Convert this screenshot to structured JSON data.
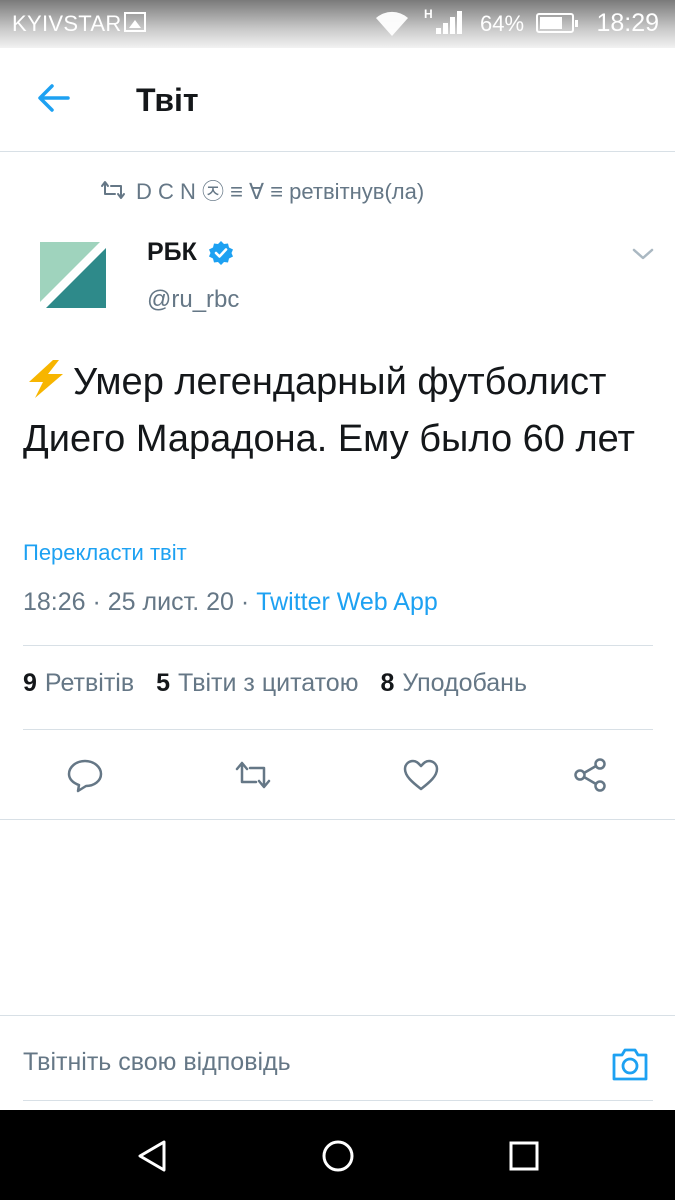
{
  "status_bar": {
    "carrier": "KYIVSTAR",
    "battery": "64%",
    "time": "18:29",
    "network": "H"
  },
  "header": {
    "title": "Твіт"
  },
  "retweet_context": {
    "text": "D C N ㉨ ≡ ∀ ≡ ретвітнув(ла)"
  },
  "tweet": {
    "author_name": "РБК",
    "author_handle": "@ru_rbc",
    "verified": true,
    "text": "Умер легендарный футболист Диего Марадона. Ему было 60 лет",
    "translate": "Перекласти твіт",
    "timestamp": "18:26 · 25 лист. 20 · ",
    "app": "Twitter Web App"
  },
  "stats": {
    "retweets_count": "9",
    "retweets_label": "Ретвітів",
    "quotes_count": "5",
    "quotes_label": "Твіти з цитатою",
    "likes_count": "8",
    "likes_label": "Уподобань"
  },
  "reply": {
    "placeholder": "Твітніть свою відповідь"
  },
  "colors": {
    "accent": "#1da1f2",
    "text_primary": "#14171a",
    "text_secondary": "#657786",
    "divider": "#d8e0e6"
  }
}
